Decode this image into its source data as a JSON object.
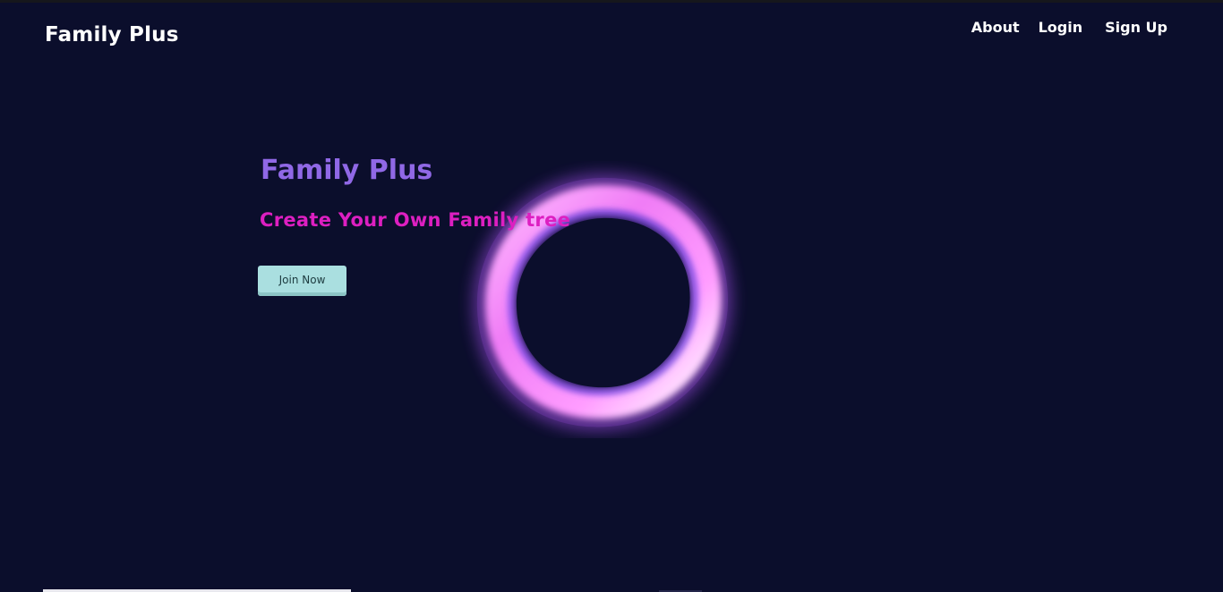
{
  "header": {
    "brand": "Family Plus",
    "nav": [
      {
        "label": "About"
      },
      {
        "label": "Login"
      },
      {
        "label": "Sign Up"
      }
    ]
  },
  "hero": {
    "title": "Family Plus",
    "subtitle": "Create Your Own Family tree",
    "cta_label": "Join Now"
  },
  "colors": {
    "background": "#0b0e2c",
    "title": "#9068e6",
    "subtitle": "#dd1fc1",
    "cta_background": "#aadfe0",
    "ring_primary": "#f08cff",
    "ring_glow": "#7a4dff"
  },
  "icons": {
    "ring": "glowing-ring-graphic"
  }
}
